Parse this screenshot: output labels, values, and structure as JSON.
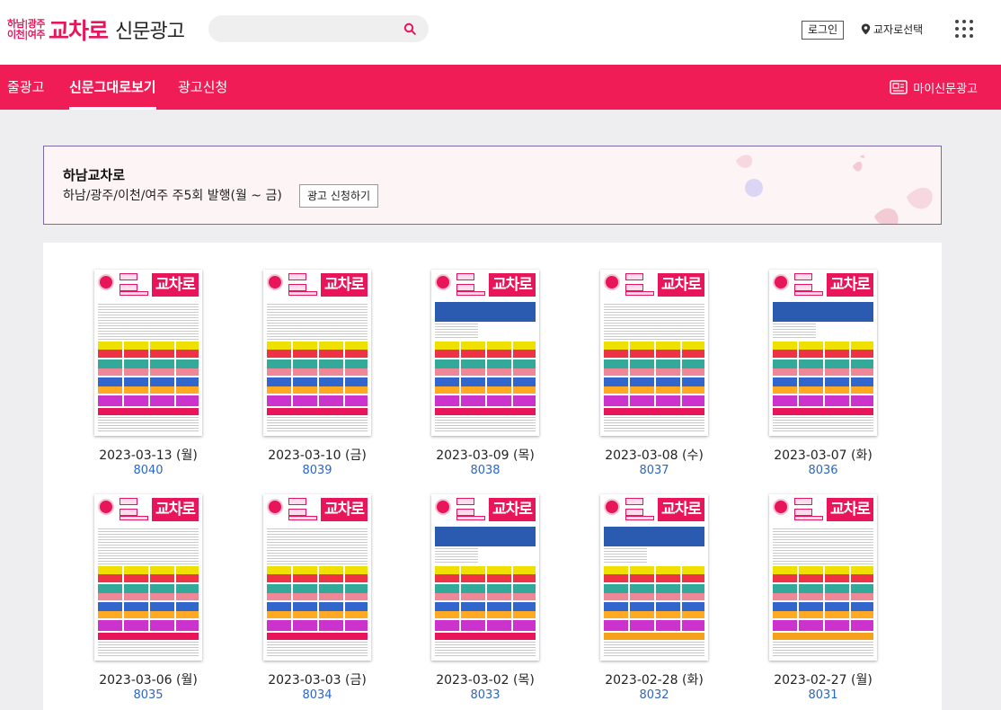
{
  "header": {
    "logo_region_top": "하남|광주",
    "logo_region_bottom": "이천|여주",
    "logo_main": "교차로",
    "logo_sub": "신문광고",
    "search_placeholder": "",
    "login_label": "로그인",
    "region_label": "교자로선택"
  },
  "nav": {
    "tabs": [
      {
        "label": "줄광고"
      },
      {
        "label": "신문그대로보기"
      },
      {
        "label": "광고신청"
      }
    ],
    "active_tab": "신문그대로보기",
    "my_ad_label": "마이신문광고"
  },
  "banner": {
    "title": "하남교차로",
    "description": "하남/광주/이천/여주 주5회 발행(월 ~ 금)",
    "apply_label": "광고 신청하기"
  },
  "papers": [
    {
      "date": "2023-03-13 (월)",
      "number": "8040",
      "masthead": "교차로"
    },
    {
      "date": "2023-03-10 (금)",
      "number": "8039",
      "masthead": "교차로"
    },
    {
      "date": "2023-03-09 (목)",
      "number": "8038",
      "masthead": "교차로"
    },
    {
      "date": "2023-03-08 (수)",
      "number": "8037",
      "masthead": "교차로"
    },
    {
      "date": "2023-03-07 (화)",
      "number": "8036",
      "masthead": "교차로"
    },
    {
      "date": "2023-03-06 (월)",
      "number": "8035",
      "masthead": "교차로"
    },
    {
      "date": "2023-03-03 (금)",
      "number": "8034",
      "masthead": "교차로"
    },
    {
      "date": "2023-03-02 (목)",
      "number": "8033",
      "masthead": "교차로"
    },
    {
      "date": "2023-02-28 (화)",
      "number": "8032",
      "masthead": "교차로"
    },
    {
      "date": "2023-02-27 (월)",
      "number": "8031",
      "masthead": "교차로"
    }
  ],
  "colors": {
    "brand": "#f01c55",
    "link": "#2a66c8"
  }
}
